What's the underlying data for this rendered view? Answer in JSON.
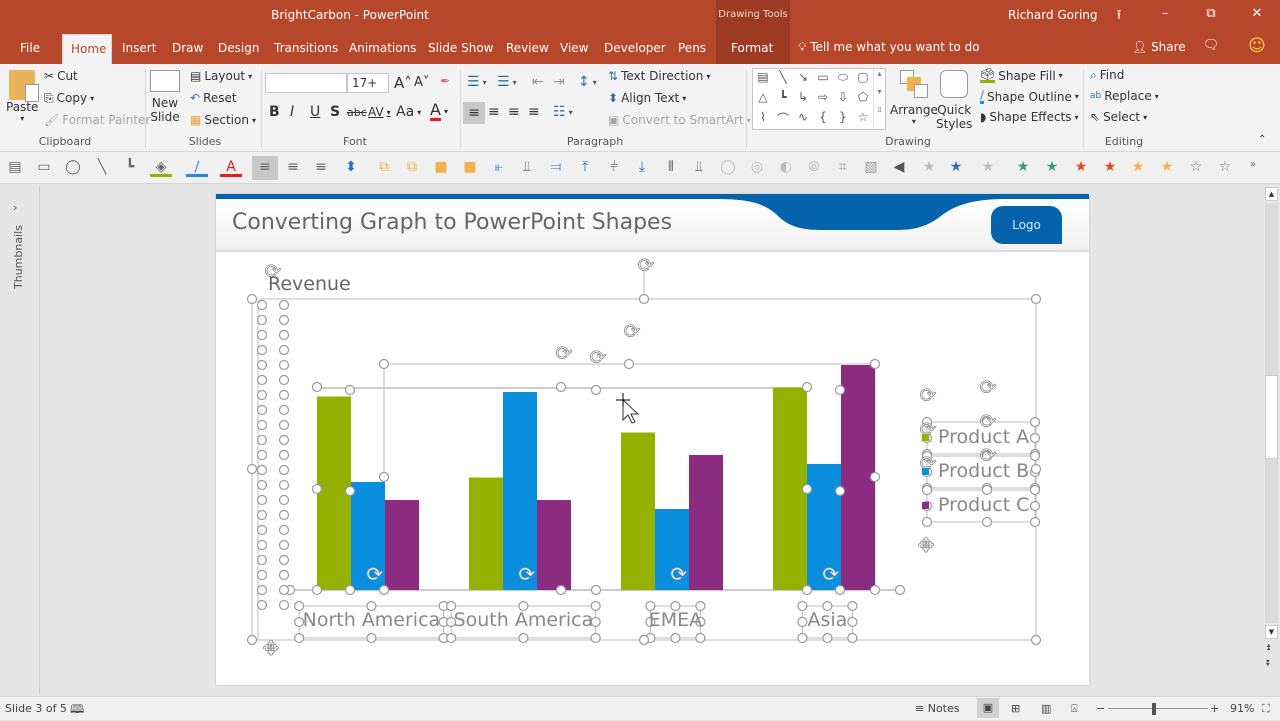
{
  "window": {
    "title": "BrightCarbon - PowerPoint",
    "contextual_group": "Drawing Tools",
    "user": "Richard Goring",
    "controls": [
      "ribbon-display-icon",
      "minimize-icon",
      "restore-icon",
      "close-icon"
    ]
  },
  "tabs": [
    {
      "label": "File"
    },
    {
      "label": "Home",
      "active": true
    },
    {
      "label": "Insert"
    },
    {
      "label": "Draw"
    },
    {
      "label": "Design"
    },
    {
      "label": "Transitions"
    },
    {
      "label": "Animations"
    },
    {
      "label": "Slide Show"
    },
    {
      "label": "Review"
    },
    {
      "label": "View"
    },
    {
      "label": "Developer"
    },
    {
      "label": "Pens"
    },
    {
      "label": "Format"
    }
  ],
  "tell_me": "Tell me what you want to do",
  "share": "Share",
  "ribbon": {
    "clipboard": {
      "paste": "Paste",
      "cut": "Cut",
      "copy": "Copy",
      "format_painter": "Format Painter",
      "label": "Clipboard"
    },
    "slides": {
      "new_slide_1": "New",
      "new_slide_2": "Slide",
      "layout": "Layout",
      "reset": "Reset",
      "section": "Section",
      "label": "Slides"
    },
    "font": {
      "font_name": "",
      "font_size": "17+",
      "label": "Font",
      "bold": "B",
      "italic": "I",
      "underline": "U",
      "shadow": "S",
      "strike": "abc",
      "spacing": "AV",
      "case": "Aa"
    },
    "paragraph": {
      "text_direction": "Text Direction",
      "align_text": "Align Text",
      "convert_smartart": "Convert to SmartArt",
      "label": "Paragraph"
    },
    "drawing": {
      "arrange": "Arrange",
      "quick_styles_1": "Quick",
      "quick_styles_2": "Styles",
      "shape_fill": "Shape Fill",
      "shape_outline": "Shape Outline",
      "shape_effects": "Shape Effects",
      "label": "Drawing"
    },
    "editing": {
      "find": "Find",
      "replace": "Replace",
      "select": "Select",
      "label": "Editing"
    }
  },
  "left_pane": {
    "label": "Thumbnails"
  },
  "slide": {
    "title": "Converting Graph to PowerPoint Shapes",
    "logo": "Logo"
  },
  "chart_data": {
    "type": "bar",
    "title": "Revenue",
    "categories": [
      "North America",
      "South America",
      "EMEA",
      "Asia"
    ],
    "series": [
      {
        "name": "Product A",
        "color": "#94b000",
        "values": [
          86,
          50,
          70,
          90
        ]
      },
      {
        "name": "Product B",
        "color": "#0a8fdf",
        "values": [
          48,
          88,
          36,
          56
        ]
      },
      {
        "name": "Product C",
        "color": "#8b2c80",
        "values": [
          40,
          40,
          60,
          100
        ]
      }
    ],
    "value_scale": "relative (no axis shown); tallest bar = 100",
    "ylim": [
      0,
      100
    ],
    "xlabel": "",
    "ylabel": "",
    "legend": "right",
    "grid": false
  },
  "status": {
    "slide_info": "Slide 3 of 5",
    "notes": "Notes",
    "zoom": "91%",
    "zoom_level": 0.91
  }
}
